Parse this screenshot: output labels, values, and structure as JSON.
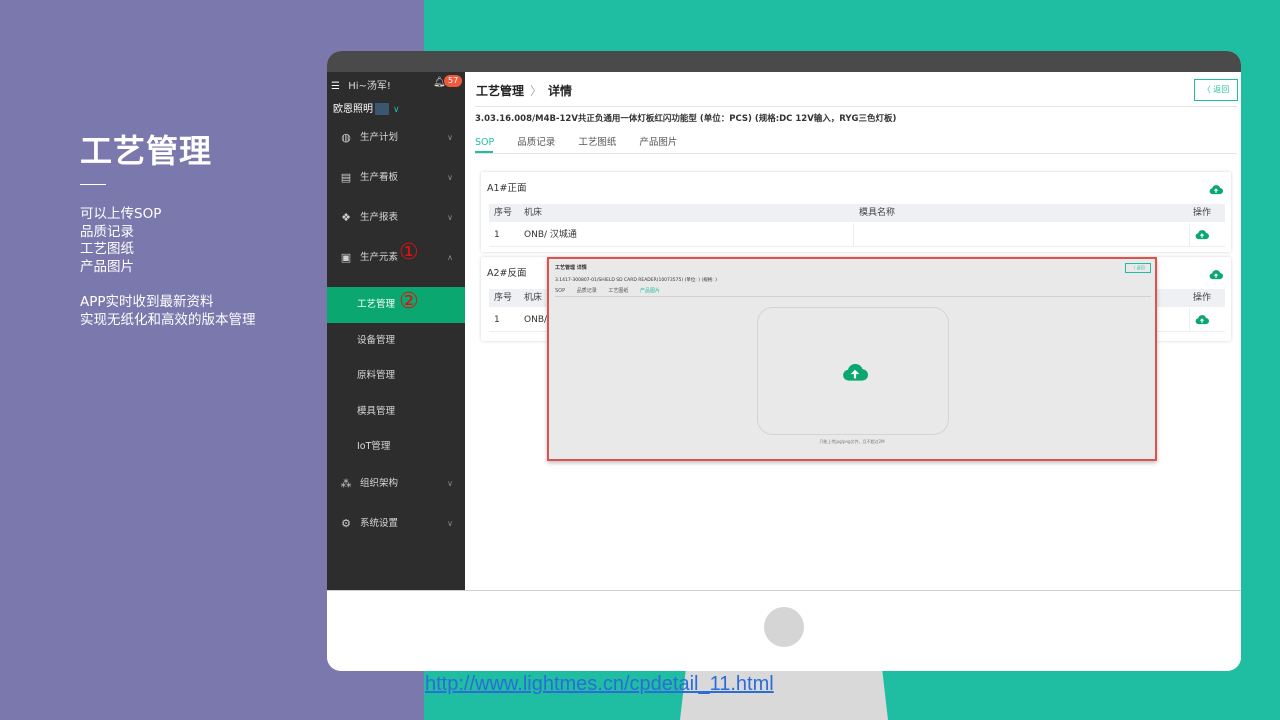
{
  "slide": {
    "title": "工艺管理",
    "lines": [
      "可以上传SOP",
      "品质记录",
      "工艺图纸",
      "产品图片"
    ],
    "lines2": [
      "APP实时收到最新资料",
      "实现无纸化和高效的版本管理"
    ],
    "link": "http://www.lightmes.cn/cpdetail_11.html"
  },
  "sidebar": {
    "greeting": "Hi~汤军!",
    "notification_count": "57",
    "org_name": "欧恩照明",
    "items": [
      {
        "label": "生产计划",
        "icon": "circle-icon"
      },
      {
        "label": "生产看板",
        "icon": "board-icon"
      },
      {
        "label": "生产报表",
        "icon": "diamond-icon"
      },
      {
        "label": "生产元素",
        "icon": "printer-icon"
      }
    ],
    "sub_items": [
      {
        "label": "工艺管理",
        "active": true
      },
      {
        "label": "设备管理"
      },
      {
        "label": "原料管理"
      },
      {
        "label": "模具管理"
      },
      {
        "label": "IoT管理"
      }
    ],
    "bottom_items": [
      {
        "label": "组织架构",
        "icon": "org-icon"
      },
      {
        "label": "系统设置",
        "icon": "gear-icon"
      }
    ],
    "annotations": [
      "①",
      "②"
    ]
  },
  "main": {
    "breadcrumb": [
      "工艺管理",
      "详情"
    ],
    "back_label": "〈 返回",
    "product": "3.03.16.008/M4B-12V共正负通用一体灯板红闪功能型 (单位：PCS) (规格:DC 12V输入，RYG三色灯板)",
    "tabs": [
      "SOP",
      "品质记录",
      "工艺图纸",
      "产品图片"
    ],
    "active_tab": "SOP",
    "table_headers": [
      "序号",
      "机床",
      "模具名称",
      "操作"
    ],
    "cards": [
      {
        "title": "A1#正面",
        "rows": [
          {
            "no": "1",
            "machine": "ONB/ 汉城通",
            "mold": ""
          }
        ]
      },
      {
        "title": "A2#反面",
        "rows": [
          {
            "no": "1",
            "machine": "ONB/",
            "mold": ""
          }
        ]
      }
    ]
  },
  "popup": {
    "breadcrumb": "工艺管理  详情",
    "back_label": "〈 返回",
    "product": "3.1417-300807-01/SHIELD SD CARD READER(10073575) (单位: ) (规格: )",
    "tabs": [
      "SOP",
      "品质记录",
      "工艺图纸",
      "产品图片"
    ],
    "active_tab": "产品图片",
    "hint": "只能上传jpg/png文件，且不超过2M"
  },
  "colors": {
    "accent": "#1fbea2",
    "sidebar_active": "#0aa870",
    "left_bg": "#7b78ad",
    "right_bg": "#1fbea2",
    "annotation": "#e01010"
  }
}
